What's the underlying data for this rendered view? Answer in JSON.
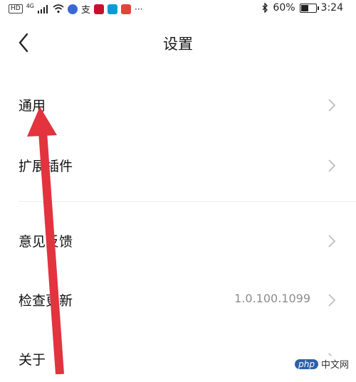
{
  "status_bar": {
    "network": "HD",
    "network_type": "4G",
    "battery_text": "60%",
    "battery_level": 0.6,
    "time": "3:24",
    "icons": [
      "wifi-icon",
      "bluetooth-icon"
    ],
    "app_colors": [
      "#c8102e",
      "#0a9bd6",
      "#e0443a"
    ]
  },
  "header": {
    "title": "设置",
    "back_icon": "chevron-left-icon"
  },
  "settings": {
    "items": [
      {
        "label": "通用",
        "value": ""
      },
      {
        "label": "扩展插件",
        "value": ""
      },
      {
        "label": "意见反馈",
        "value": ""
      },
      {
        "label": "检查更新",
        "value": "1.0.100.1099"
      },
      {
        "label": "关于",
        "value": ""
      }
    ]
  },
  "annotation": {
    "arrow_color": "#e2333f"
  },
  "watermark": {
    "logo": "php",
    "text": "中文网"
  }
}
